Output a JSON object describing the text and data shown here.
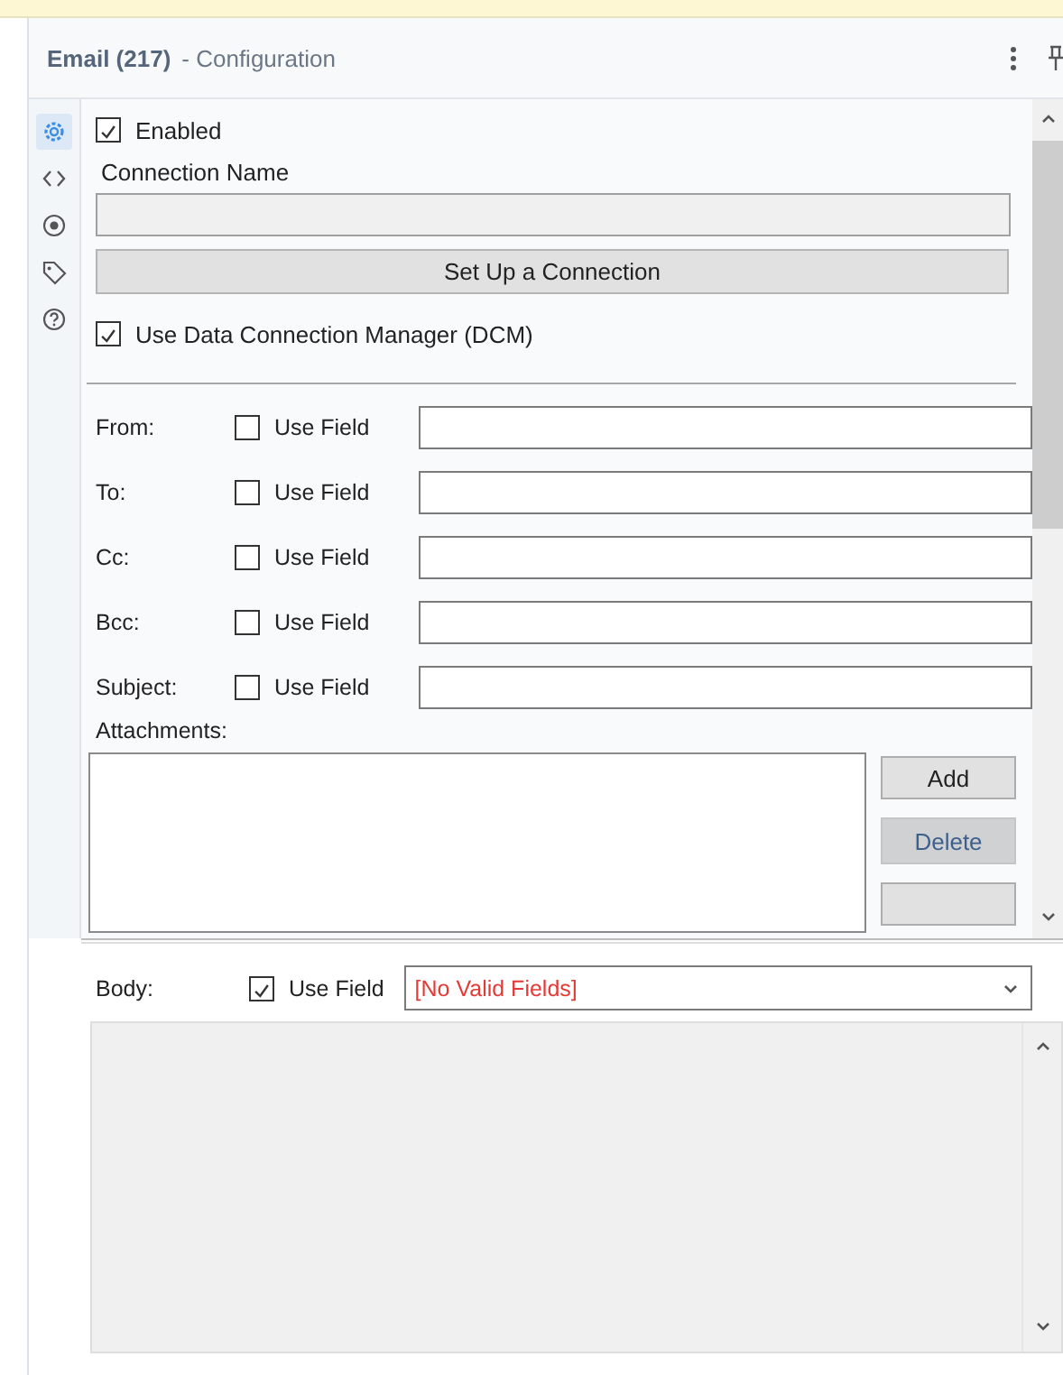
{
  "header": {
    "title": "Email (217)",
    "subtitle": "- Configuration"
  },
  "rail": [
    {
      "kind": "gear",
      "selected": true
    },
    {
      "kind": "code",
      "selected": false
    },
    {
      "kind": "target",
      "selected": false
    },
    {
      "kind": "tag",
      "selected": false
    },
    {
      "kind": "help",
      "selected": false
    }
  ],
  "enabled": {
    "label": "Enabled",
    "checked": true
  },
  "connection": {
    "label": "Connection Name",
    "button": "Set Up a Connection"
  },
  "dcm": {
    "label": "Use Data Connection Manager (DCM)",
    "checked": true
  },
  "fields": [
    {
      "label": "From:",
      "use_field": "Use Field",
      "checked": false
    },
    {
      "label": "To:",
      "use_field": "Use Field",
      "checked": false
    },
    {
      "label": "Cc:",
      "use_field": "Use Field",
      "checked": false
    },
    {
      "label": "Bcc:",
      "use_field": "Use Field",
      "checked": false
    },
    {
      "label": "Subject:",
      "use_field": "Use Field",
      "checked": false
    }
  ],
  "attachments": {
    "label": "Attachments:",
    "buttons": [
      {
        "label": "Add",
        "disabled": false
      },
      {
        "label": "Delete",
        "disabled": true
      }
    ]
  },
  "body": {
    "label": "Body:",
    "use_field": "Use Field",
    "checked": true,
    "dropdown": "[No Valid Fields]"
  }
}
